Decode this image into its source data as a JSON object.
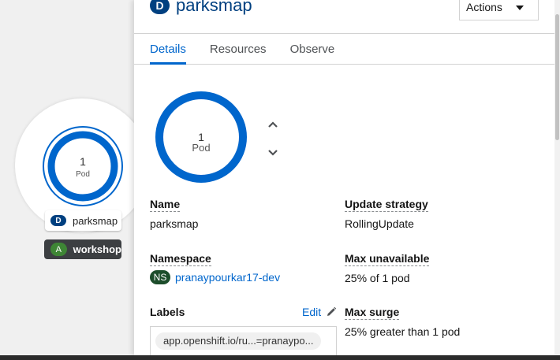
{
  "topology": {
    "node": {
      "pod_count": "1",
      "pod_unit": "Pod"
    },
    "deployment_label": {
      "badge": "D",
      "name": "parksmap"
    },
    "application_label": {
      "badge": "A",
      "name": "workshop"
    }
  },
  "panel": {
    "header": {
      "badge": "D",
      "title": "parksmap",
      "actions_label": "Actions"
    },
    "tabs": [
      {
        "label": "Details",
        "active": true
      },
      {
        "label": "Resources",
        "active": false
      },
      {
        "label": "Observe",
        "active": false
      }
    ],
    "pod_ring": {
      "count": "1",
      "unit": "Pod"
    },
    "details": {
      "name_label": "Name",
      "name_value": "parksmap",
      "namespace_label": "Namespace",
      "namespace_badge": "NS",
      "namespace_value": "pranaypourkar17-dev",
      "labels_label": "Labels",
      "labels_edit": "Edit",
      "labels": [
        "app.openshift.io/ru...=pranaypo..."
      ],
      "update_strategy_label": "Update strategy",
      "update_strategy_value": "RollingUpdate",
      "max_unavailable_label": "Max unavailable",
      "max_unavailable_value": "25% of 1 pod",
      "max_surge_label": "Max surge",
      "max_surge_value": "25% greater than 1 pod"
    }
  },
  "colors": {
    "accent": "#0066cc",
    "deployment_badge": "#004080",
    "application_badge": "#3e8635",
    "namespace_badge": "#1c4d2b",
    "pod_ring": "#0066cc"
  }
}
